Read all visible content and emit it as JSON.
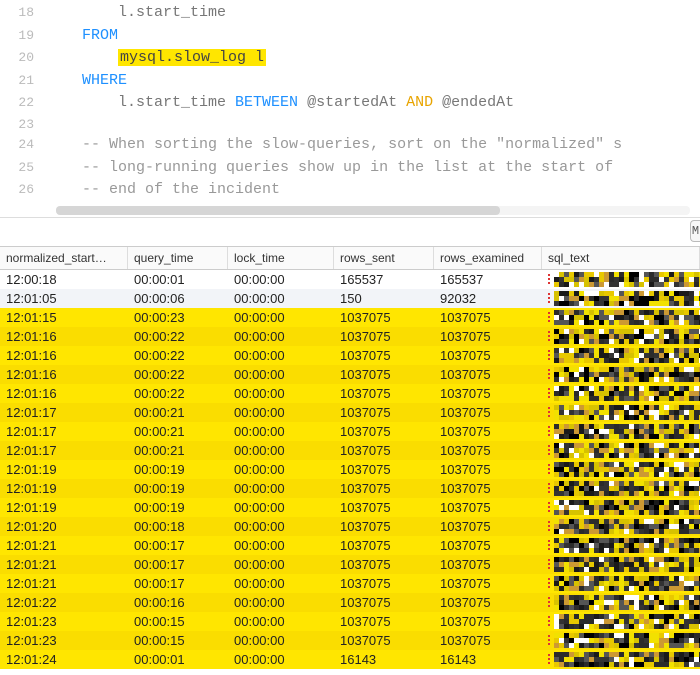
{
  "editor": {
    "lines": [
      {
        "num": 18,
        "indent": "        ",
        "tokens": [
          {
            "t": "l.start_time",
            "cls": ""
          }
        ]
      },
      {
        "num": 19,
        "indent": "    ",
        "tokens": [
          {
            "t": "FROM",
            "cls": "kw"
          }
        ]
      },
      {
        "num": 20,
        "indent": "        ",
        "tokens": [
          {
            "t": "mysql.slow_log l",
            "cls": "hl"
          }
        ]
      },
      {
        "num": 21,
        "indent": "    ",
        "tokens": [
          {
            "t": "WHERE",
            "cls": "kw"
          }
        ]
      },
      {
        "num": 22,
        "indent": "        ",
        "tokens": [
          {
            "t": "l.start_time ",
            "cls": ""
          },
          {
            "t": "BETWEEN",
            "cls": "kw"
          },
          {
            "t": " @startedAt ",
            "cls": "var"
          },
          {
            "t": "AND",
            "cls": "and"
          },
          {
            "t": " @endedAt",
            "cls": "var"
          }
        ]
      },
      {
        "num": 23,
        "indent": "",
        "tokens": []
      },
      {
        "num": 24,
        "indent": "    ",
        "tokens": [
          {
            "t": "-- When sorting the slow-queries, sort on the \"normalized\" s",
            "cls": "comment"
          }
        ]
      },
      {
        "num": 25,
        "indent": "    ",
        "tokens": [
          {
            "t": "-- long-running queries show up in the list at the start of",
            "cls": "comment"
          }
        ]
      },
      {
        "num": 26,
        "indent": "    ",
        "tokens": [
          {
            "t": "-- end of the incident",
            "cls": "comment"
          }
        ]
      }
    ]
  },
  "button_right": "M",
  "grid": {
    "headers": [
      "normalized_start…",
      "query_time",
      "lock_time",
      "rows_sent",
      "rows_examined",
      "sql_text"
    ],
    "rows": [
      {
        "hl": false,
        "cells": [
          "12:00:18",
          "00:00:01",
          "00:00:00",
          "165537",
          "165537",
          ""
        ]
      },
      {
        "hl": false,
        "cells": [
          "12:01:05",
          "00:00:06",
          "00:00:00",
          "150",
          "92032",
          ""
        ]
      },
      {
        "hl": true,
        "cells": [
          "12:01:15",
          "00:00:23",
          "00:00:00",
          "1037075",
          "1037075",
          ""
        ]
      },
      {
        "hl": true,
        "cells": [
          "12:01:16",
          "00:00:22",
          "00:00:00",
          "1037075",
          "1037075",
          ""
        ]
      },
      {
        "hl": true,
        "cells": [
          "12:01:16",
          "00:00:22",
          "00:00:00",
          "1037075",
          "1037075",
          ""
        ]
      },
      {
        "hl": true,
        "cells": [
          "12:01:16",
          "00:00:22",
          "00:00:00",
          "1037075",
          "1037075",
          ""
        ]
      },
      {
        "hl": true,
        "cells": [
          "12:01:16",
          "00:00:22",
          "00:00:00",
          "1037075",
          "1037075",
          ""
        ]
      },
      {
        "hl": true,
        "cells": [
          "12:01:17",
          "00:00:21",
          "00:00:00",
          "1037075",
          "1037075",
          ""
        ]
      },
      {
        "hl": true,
        "cells": [
          "12:01:17",
          "00:00:21",
          "00:00:00",
          "1037075",
          "1037075",
          ""
        ]
      },
      {
        "hl": true,
        "cells": [
          "12:01:17",
          "00:00:21",
          "00:00:00",
          "1037075",
          "1037075",
          ""
        ]
      },
      {
        "hl": true,
        "cells": [
          "12:01:19",
          "00:00:19",
          "00:00:00",
          "1037075",
          "1037075",
          ""
        ]
      },
      {
        "hl": true,
        "cells": [
          "12:01:19",
          "00:00:19",
          "00:00:00",
          "1037075",
          "1037075",
          ""
        ]
      },
      {
        "hl": true,
        "cells": [
          "12:01:19",
          "00:00:19",
          "00:00:00",
          "1037075",
          "1037075",
          ""
        ]
      },
      {
        "hl": true,
        "cells": [
          "12:01:20",
          "00:00:18",
          "00:00:00",
          "1037075",
          "1037075",
          ""
        ]
      },
      {
        "hl": true,
        "cells": [
          "12:01:21",
          "00:00:17",
          "00:00:00",
          "1037075",
          "1037075",
          ""
        ]
      },
      {
        "hl": true,
        "cells": [
          "12:01:21",
          "00:00:17",
          "00:00:00",
          "1037075",
          "1037075",
          ""
        ]
      },
      {
        "hl": true,
        "cells": [
          "12:01:21",
          "00:00:17",
          "00:00:00",
          "1037075",
          "1037075",
          ""
        ]
      },
      {
        "hl": true,
        "cells": [
          "12:01:22",
          "00:00:16",
          "00:00:00",
          "1037075",
          "1037075",
          ""
        ]
      },
      {
        "hl": true,
        "cells": [
          "12:01:23",
          "00:00:15",
          "00:00:00",
          "1037075",
          "1037075",
          ""
        ]
      },
      {
        "hl": true,
        "cells": [
          "12:01:23",
          "00:00:15",
          "00:00:00",
          "1037075",
          "1037075",
          ""
        ]
      },
      {
        "hl": true,
        "cells": [
          "12:01:24",
          "00:00:01",
          "00:00:00",
          "16143",
          "16143",
          ""
        ]
      }
    ]
  }
}
